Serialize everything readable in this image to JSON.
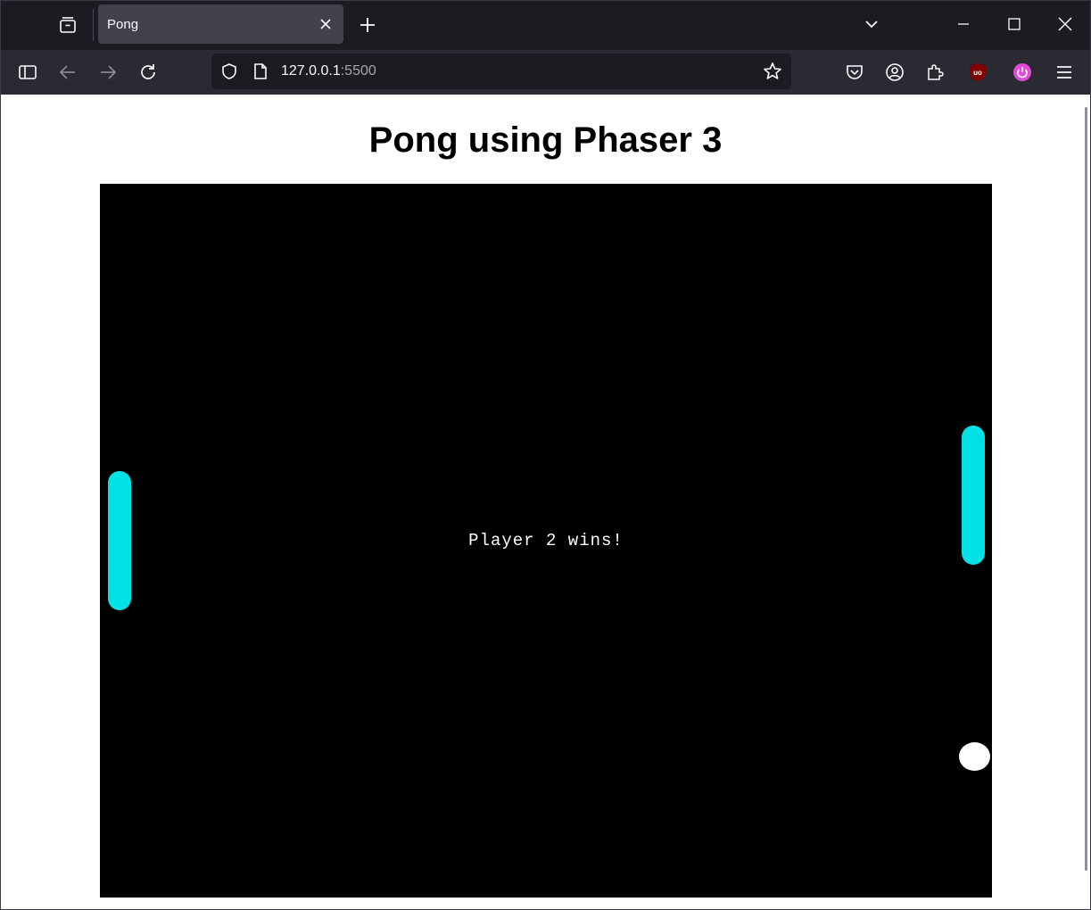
{
  "browser": {
    "tab": {
      "title": "Pong"
    },
    "url": {
      "host": "127.0.0.1",
      "port": ":5500"
    },
    "icons": {
      "tab_overview": "tab-overview-icon",
      "close_tab": "close-icon",
      "new_tab": "plus-icon",
      "list_tabs": "chevron-down-icon",
      "minimize": "minimize-icon",
      "maximize": "maximize-icon",
      "close_window": "close-icon",
      "sidebar": "sidebar-icon",
      "back": "back-arrow-icon",
      "forward": "forward-arrow-icon",
      "reload": "reload-icon",
      "tracking_shield": "shield-icon",
      "page_info": "page-icon",
      "bookmark": "star-icon",
      "pocket": "pocket-icon",
      "account": "account-icon",
      "extensions": "puzzle-icon",
      "ublock": "ublock-icon",
      "power_extension": "power-icon",
      "menu": "hamburger-menu-icon"
    }
  },
  "page": {
    "heading": "Pong using Phaser 3"
  },
  "game": {
    "status_text": "Player 2 wins!",
    "colors": {
      "background": "#000000",
      "paddle": "#00e1e6",
      "ball": "#ffffff",
      "text": "#ffffff"
    }
  }
}
